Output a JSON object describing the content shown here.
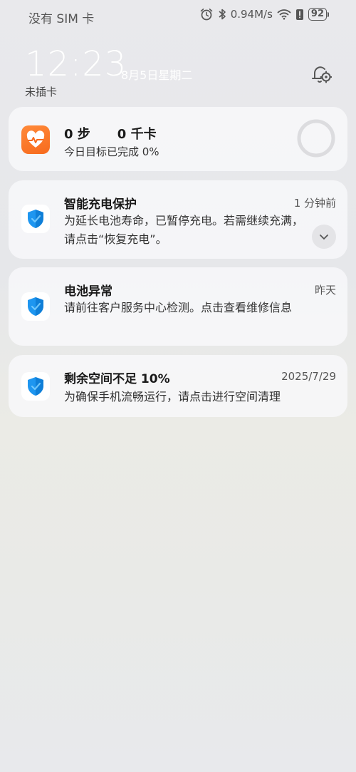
{
  "status_bar": {
    "carrier": "没有 SIM 卡",
    "net_speed": "0.94M/s",
    "battery": "92",
    "icons": [
      "alarm-icon",
      "bluetooth-icon",
      "wifi-icon",
      "vibrate-alert-icon",
      "battery-icon"
    ]
  },
  "lockscreen": {
    "time": "12:23",
    "date": "8月5日星期二",
    "sim_status": "未插卡",
    "settings_icon": "gear-notification-settings-icon"
  },
  "health_card": {
    "icon": "health-heart-icon",
    "steps": "0 步",
    "calories": "0 千卡",
    "goal_text": "今日目标已完成 0%",
    "progress": 0
  },
  "notifications": [
    {
      "icon": "shield-icon",
      "title": "智能充电保护",
      "time": "1 分钟前",
      "body": "为延长电池寿命，已暂停充电。若需继续充满，请点击“恢复充电”。",
      "expand_icon": "chevron-down-icon"
    },
    {
      "icon": "shield-icon",
      "title": "电池异常",
      "time": "昨天",
      "body": "请前往客户服务中心检测。点击查看维修信息"
    },
    {
      "icon": "shield-icon",
      "title": "剩余空间不足 10%",
      "time": "2025/7/29",
      "body": "为确保手机流畅运行，请点击进行空间清理"
    }
  ],
  "colors": {
    "health_accent": "#f76a1d",
    "shield_blue": "#1e96f0",
    "card_bg": "#f6f6f8"
  }
}
